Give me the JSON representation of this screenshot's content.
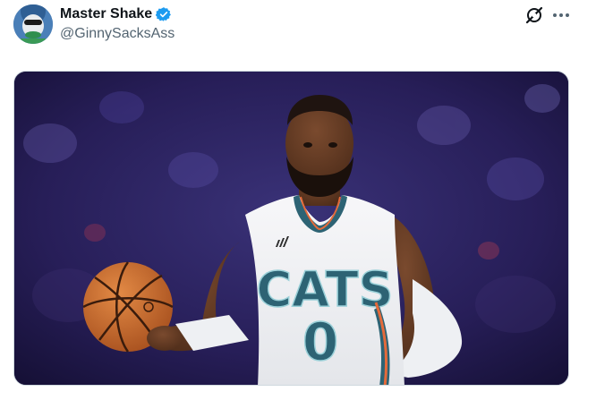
{
  "tweet": {
    "author": {
      "display_name": "Master Shake",
      "handle": "@GinnySacksAss",
      "verified": true
    },
    "media": {
      "jersey_text": "CATS",
      "jersey_number": "0"
    },
    "icons": {
      "grok": "grok-icon",
      "more": "more-icon",
      "verified": "verified-badge-icon"
    },
    "colors": {
      "verified_blue": "#1d9bf0",
      "handle_gray": "#536471",
      "jersey_teal": "#2d6374"
    }
  }
}
